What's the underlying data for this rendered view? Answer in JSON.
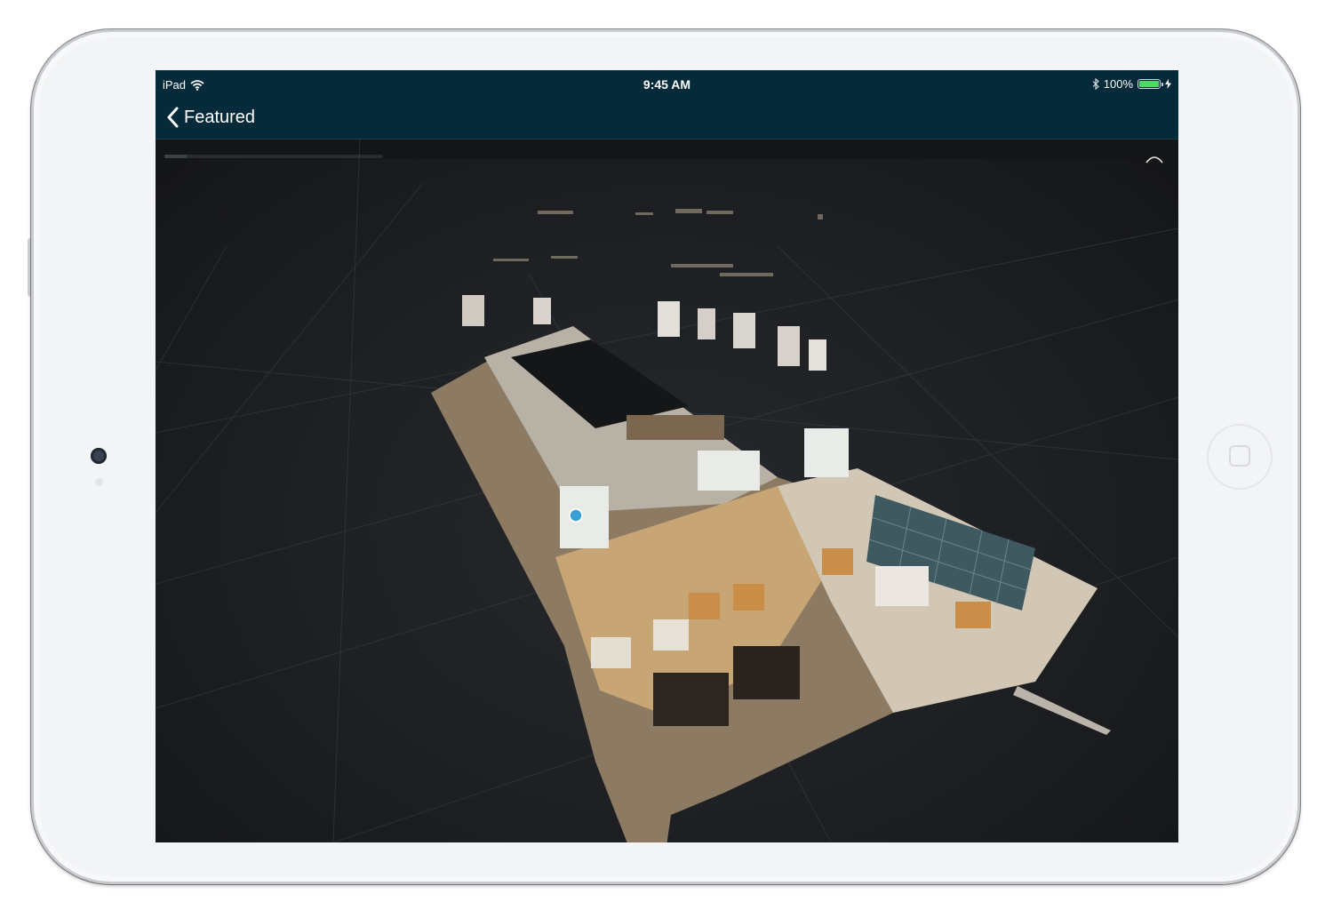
{
  "device": {
    "model": "iPad"
  },
  "status_bar": {
    "carrier": "iPad",
    "time": "9:45 AM",
    "battery_percent": "100%",
    "battery_level": 1.0,
    "icons": [
      "wifi-icon",
      "bluetooth-icon",
      "battery-icon",
      "charging-bolt-icon"
    ]
  },
  "nav_bar": {
    "back_label": "Featured",
    "back_icon": "chevron-left-icon",
    "background_color": "#052a3a"
  },
  "viewer": {
    "mode": "dollhouse-3d-model",
    "loading_progress": 0.1
  },
  "colors": {
    "screen_background": "#1b1c1e",
    "battery_fill": "#4cd964"
  }
}
